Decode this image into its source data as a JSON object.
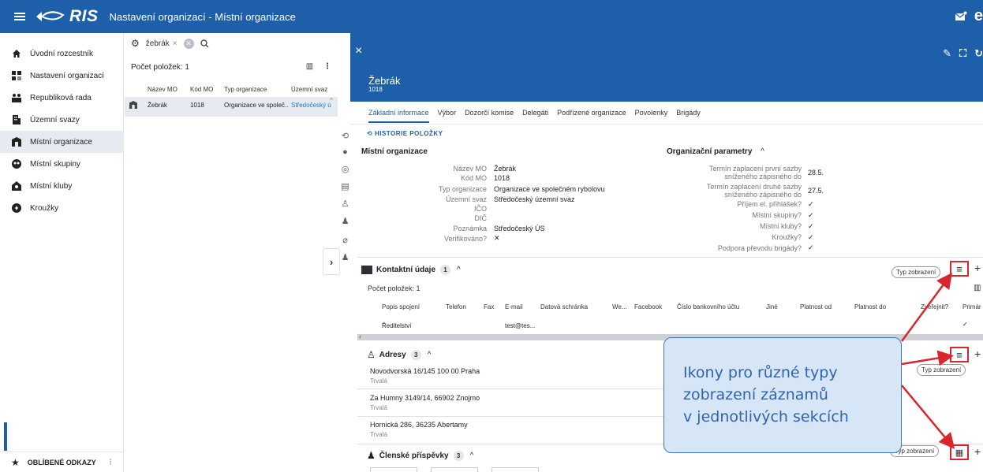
{
  "app": {
    "logo_text": "RIS",
    "title": "Nastavení organizací - Místní organizace",
    "user_letter": "e",
    "colors": {
      "primary": "#1d5fa8",
      "accent_red": "#d9262e",
      "callout_bg": "#d7e6f7",
      "callout_text": "#2f63ad",
      "link": "#1d78c9"
    }
  },
  "nav": {
    "items": [
      {
        "label": "Úvodní rozcestník",
        "icon": "home-icon",
        "active": false
      },
      {
        "label": "Nastavení organizací",
        "icon": "org-settings-icon",
        "active": false
      },
      {
        "label": "Republiková rada",
        "icon": "council-icon",
        "active": false
      },
      {
        "label": "Územní svazy",
        "icon": "building-icon",
        "active": false
      },
      {
        "label": "Místní organizace",
        "icon": "bank-icon",
        "active": true
      },
      {
        "label": "Místní skupiny",
        "icon": "group-icon",
        "active": false
      },
      {
        "label": "Místní kluby",
        "icon": "club-icon",
        "active": false
      },
      {
        "label": "Kroužky",
        "icon": "circle-icon",
        "active": false
      }
    ],
    "favorites_label": "OBLÍBENÉ ODKAZY"
  },
  "list": {
    "filter_chip": "žebrák",
    "count_label": "Počet položek: 1",
    "columns": [
      "Název MO",
      "Kód MO",
      "Typ organizace",
      "Územní svaz"
    ],
    "rows": [
      {
        "name": "Žebrák",
        "code": "1018",
        "type": "Organizace ve společ...",
        "svaz": "Středočeský úz..."
      }
    ]
  },
  "detail": {
    "name": "Žebrák",
    "code": "1018",
    "tabs": [
      "Základní informace",
      "Výbor",
      "Dozorčí komise",
      "Delegáti",
      "Podřízené organizace",
      "Povolenky",
      "Brigády"
    ],
    "history_label": "HISTORIE POLOŽKY",
    "org_section": {
      "title": "Místní organizace",
      "fields": [
        {
          "label": "Název MO",
          "value": "Žebrák"
        },
        {
          "label": "Kód MO",
          "value": "1018"
        },
        {
          "label": "Typ organizace",
          "value": "Organizace ve společném rybolovu"
        },
        {
          "label": "Územní svaz",
          "value": "Středočeský územní svaz"
        },
        {
          "label": "IČO",
          "value": ""
        },
        {
          "label": "DIČ",
          "value": ""
        },
        {
          "label": "Poznámka",
          "value": "Středočeský ÚS"
        },
        {
          "label": "Verifikováno?",
          "value": "✕"
        }
      ]
    },
    "params_section": {
      "title": "Organizační parametry",
      "fields": [
        {
          "label": "Termín zaplacení první sazby",
          "label2": "sníženého zápisného do",
          "value": "28.5."
        },
        {
          "label": "Termín zaplacení druhé sazby",
          "label2": "sníženého zápisného do",
          "value": "27.5."
        },
        {
          "label": "Příjem el. přihlášek?",
          "value": "✓"
        },
        {
          "label": "Místní skupiny?",
          "value": "✓"
        },
        {
          "label": "Místní kluby?",
          "value": "✓"
        },
        {
          "label": "Kroužky?",
          "value": "✓"
        },
        {
          "label": "Podpora převodu brigády?",
          "value": "✓"
        }
      ]
    },
    "contacts": {
      "title": "Kontaktní údaje",
      "badge": "1",
      "count_label": "Počet položek: 1",
      "columns": [
        "Popis spojení",
        "Telefon",
        "Fax",
        "E-mail",
        "Datová schránka",
        "We...",
        "Facebook",
        "Číslo bankovního účtu",
        "Jiné",
        "Platnost od",
        "Platnost do",
        "Zveřejnit?",
        "Primár"
      ],
      "row": {
        "popis": "Ředitelství",
        "email": "test@tes...",
        "primary": "✓"
      }
    },
    "addresses": {
      "title": "Adresy",
      "badge": "3",
      "items": [
        {
          "line": "Novodvorská 16/145 100 00 Praha",
          "type": "Trvalá"
        },
        {
          "line": "Za Humny 3149/14, 66902 Znojmo",
          "type": "Trvalá"
        },
        {
          "line": "Hornická 286, 36235 Abertamy",
          "type": "Trvalá"
        }
      ]
    },
    "fees": {
      "title": "Členské příspěvky",
      "badge": "3"
    },
    "view_type_label": "Typ zobrazení"
  },
  "callout": {
    "lines": [
      "Ikony pro různé typy",
      "zobrazení záznamů",
      "v jednotlivých sekcích"
    ]
  }
}
